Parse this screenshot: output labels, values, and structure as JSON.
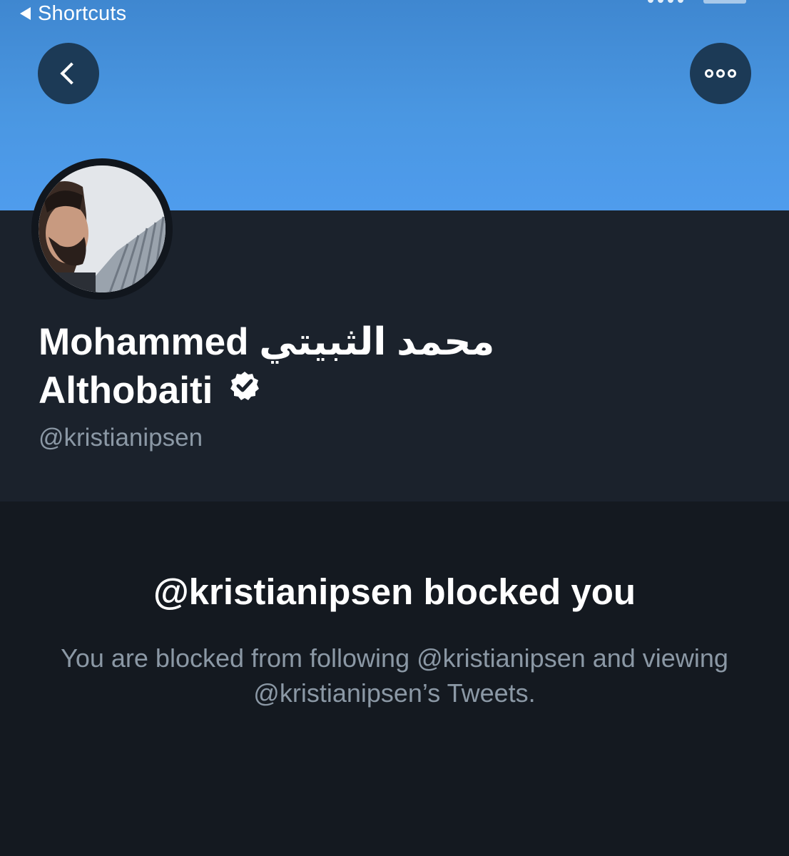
{
  "status_bar": {
    "back_label": "Shortcuts"
  },
  "header": {
    "back_icon": "chevron-left-icon",
    "more_icon": "more-horizontal-icon"
  },
  "profile": {
    "display_name": "Mohammed محمد الثبيتي Althobaiti",
    "verified_icon": "verified-badge-icon",
    "handle": "@kristianipsen"
  },
  "blocked": {
    "title": "@kristianipsen blocked you",
    "description": "You are blocked from following @kristianipsen and viewing @kristianipsen’s Tweets."
  },
  "colors": {
    "banner": "#4a97e2",
    "profile_bg": "#1b222c",
    "page_bg": "#141920",
    "secondary_text": "#8b98a5"
  }
}
